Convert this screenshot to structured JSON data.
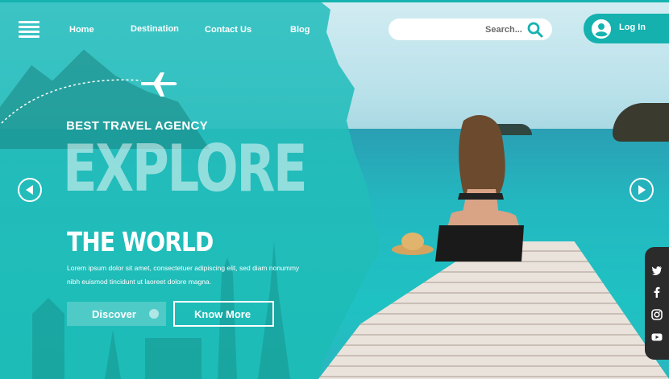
{
  "nav": {
    "menu_icon": "hamburger-menu-icon",
    "links": [
      "Home",
      "Destination",
      "Contact Us",
      "Blog"
    ]
  },
  "search": {
    "placeholder": "Search...",
    "icon": "search-icon"
  },
  "login": {
    "label": "Log In",
    "icon": "user-avatar-icon"
  },
  "hero": {
    "kicker": "BEST TRAVEL AGENCY",
    "headline": "EXPLORE",
    "subheadline": "THE WORLD",
    "description": "Lorem ipsum dolor sit amet, consectetuer adipiscing elit, sed diam nonummy nibh euismod tincidunt ut laoreet dolore magna.",
    "discover_label": "Discover",
    "know_more_label": "Know More"
  },
  "carousel": {
    "prev_icon": "arrow-left-icon",
    "next_icon": "arrow-right-icon"
  },
  "social": [
    "twitter-icon",
    "facebook-icon",
    "instagram-icon",
    "youtube-icon"
  ],
  "colors": {
    "accent": "#16b3b0",
    "overlay": "#1fbcb6",
    "social_bar": "#2b2b2b"
  }
}
